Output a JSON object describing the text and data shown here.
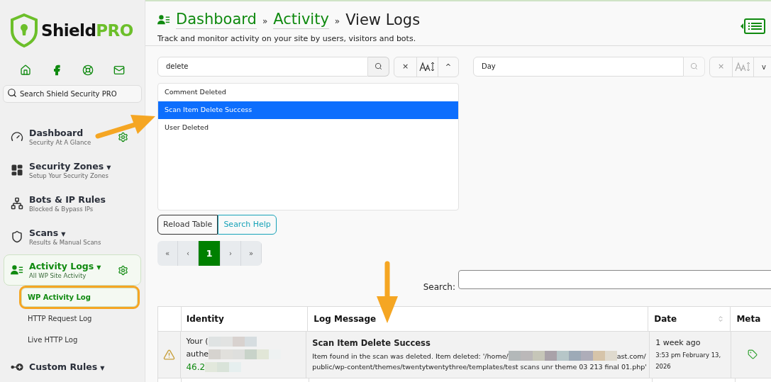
{
  "brand": {
    "name_dark": "Shield",
    "name_accent": "PRO"
  },
  "sidebar": {
    "search_placeholder": "Search Shield Security PRO",
    "items": [
      {
        "kind": "dashboard",
        "title": "Dashboard",
        "subtitle": "Security At A Glance",
        "gear": true,
        "selected": false
      },
      {
        "kind": "zones",
        "title": "Security Zones",
        "subtitle": "Setup Your Security Zones",
        "caret": "▼",
        "gear": false,
        "selected": false
      },
      {
        "kind": "bots",
        "title": "Bots & IP Rules",
        "subtitle": "Blocked & Bypass IPs",
        "gear": false,
        "selected": false
      },
      {
        "kind": "scans",
        "title": "Scans",
        "subtitle": "Results & Manual Scans",
        "caret": "▼",
        "gear": false,
        "selected": false
      },
      {
        "kind": "activity",
        "title": "Activity Logs",
        "subtitle": "All WP Site Activity",
        "caret": "▼",
        "gear": true,
        "selected": true,
        "children": [
          {
            "label": "WP Activity Log",
            "selected": true,
            "highlighted": true
          },
          {
            "label": "HTTP Request Log",
            "selected": false,
            "highlighted": false
          },
          {
            "label": "Live HTTP Log",
            "selected": false,
            "highlighted": false
          }
        ]
      },
      {
        "kind": "rules",
        "title": "Custom Rules",
        "caret": "▼",
        "gear": false,
        "selected": false
      }
    ]
  },
  "breadcrumb": [
    {
      "label": "Dashboard",
      "link": true
    },
    {
      "label": "Activity",
      "link": true
    },
    {
      "label": "View Logs",
      "link": false
    }
  ],
  "breadcrumb_separator": "»",
  "description": "Track and monitor activity on your site by users, visitors and bots.",
  "filters": [
    {
      "value": "delete",
      "expanded": true,
      "clear": "×",
      "toggle": "^",
      "options": [
        {
          "label": "Comment Deleted",
          "selected": false
        },
        {
          "label": "Scan Item Delete Success",
          "selected": true
        },
        {
          "label": "User Deleted",
          "selected": false
        }
      ]
    },
    {
      "value": "Day",
      "expanded": false,
      "clear": "×",
      "toggle": "v"
    }
  ],
  "buttons": [
    {
      "label": "Reload Table",
      "kind": "dark"
    },
    {
      "label": "Search Help",
      "kind": "info"
    }
  ],
  "pagination": [
    {
      "label": "«",
      "selected": false
    },
    {
      "label": "‹",
      "selected": false
    },
    {
      "label": "1",
      "selected": true
    },
    {
      "label": "›",
      "selected": false
    },
    {
      "label": "»",
      "selected": false
    }
  ],
  "search_label": "Search:",
  "table": {
    "columns": [
      "Identity",
      "Log Message",
      "Date",
      "Meta"
    ],
    "rows": [
      {
        "identity_lines": [
          "Your (",
          "authe",
          "46.2"
        ],
        "title": "Scan Item Delete Success",
        "message_start": "Item found in the scan was deleted. Item deleted: '/home/",
        "message_after": "ast.com/",
        "message_line2": "public/wp-content/themes/twentytwentythree/templates/test scans unr theme 03 213 final 01.php'",
        "ago": "1 week ago",
        "date": "3:53 pm February 13, 2026"
      }
    ]
  }
}
